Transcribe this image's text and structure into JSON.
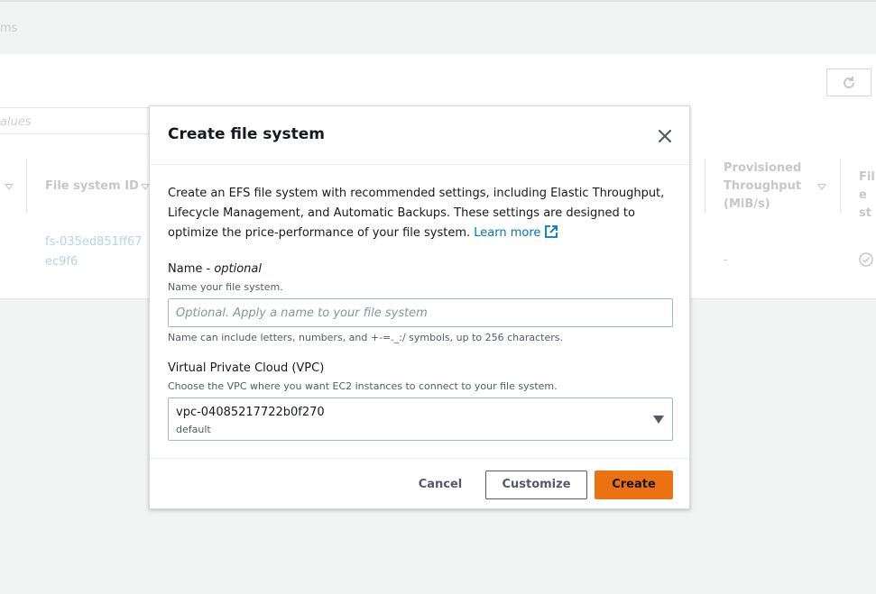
{
  "background": {
    "breadcrumb_fragment": "ms",
    "filter_placeholder_fragment": "alues",
    "columns": [
      {
        "label": "File system ID"
      },
      {
        "label": "Provisioned Throughput (MiB/s)"
      },
      {
        "label": "File st"
      }
    ],
    "row": {
      "file_system_id": "fs-035ed851ff67ec9f6",
      "provisioned_throughput": "-"
    }
  },
  "modal": {
    "title": "Create file system",
    "description": "Create an EFS file system with recommended settings, including Elastic Throughput, Lifecycle Management, and Automatic Backups. These settings are designed to optimize the price-performance of your file system.",
    "learn_more": "Learn more",
    "name_field": {
      "label": "Name - ",
      "label_optional": "optional",
      "description": "Name your file system.",
      "placeholder": "Optional. Apply a name to your file system",
      "value": "",
      "constraint": "Name can include letters, numbers, and +-=._:/ symbols, up to 256 characters."
    },
    "vpc_field": {
      "label": "Virtual Private Cloud (VPC)",
      "description": "Choose the VPC where you want EC2 instances to connect to your file system.",
      "selected_value": "vpc-04085217722b0f270",
      "selected_description": "default"
    },
    "buttons": {
      "cancel": "Cancel",
      "customize": "Customize",
      "create": "Create"
    }
  },
  "colors": {
    "primary_button": "#ec7211",
    "link": "#0073bb"
  }
}
